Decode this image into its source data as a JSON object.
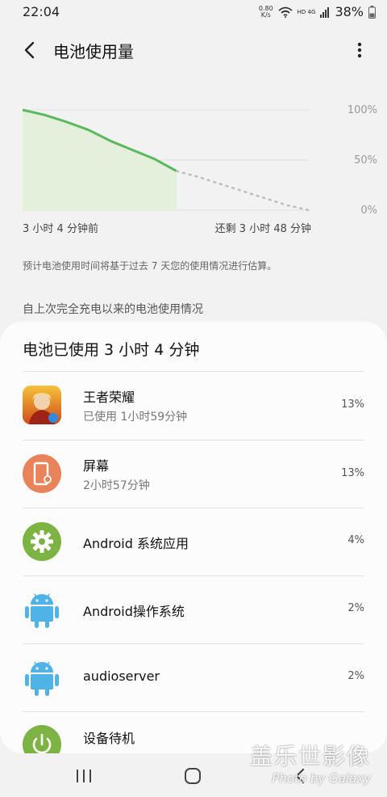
{
  "status": {
    "time": "22:04",
    "net_speed_value": "0.80",
    "net_speed_unit": "K/s",
    "network_label": "HD 4G",
    "battery_percent": "38%"
  },
  "header": {
    "title": "电池使用量"
  },
  "chart": {
    "left_label": "3 小时 4 分钟前",
    "right_label": "还剩 3 小时 48 分钟",
    "y_ticks": [
      "100%",
      "50%",
      "0%"
    ],
    "colors": {
      "usage_line": "#5cb85c",
      "usage_fill": "#dff0d8",
      "prediction": "#bdbdbd"
    }
  },
  "chart_data": {
    "type": "line",
    "series": [
      {
        "values": [
          100,
          95,
          88,
          80,
          69,
          60,
          51,
          39
        ]
      },
      {
        "values": [
          39,
          33,
          26,
          19,
          12,
          5,
          0
        ]
      }
    ],
    "ylim": [
      0,
      100
    ],
    "yticks": [
      "100%",
      "50%",
      "0%"
    ]
  },
  "estimate_note": "预计电池使用时间将基于过去 7 天您的使用情况进行估算。",
  "section_header": "自上次完全充电以来的电池使用情况",
  "usage_card": {
    "title": "电池已使用 3 小时 4 分钟",
    "items": [
      {
        "name": "王者荣耀",
        "detail": "已使用 1小时59分钟",
        "percent": "13%",
        "icon": "game-app-icon"
      },
      {
        "name": "屏幕",
        "detail": "2小时57分钟",
        "percent": "13%",
        "icon": "screen-icon"
      },
      {
        "name": "Android 系统应用",
        "detail": "",
        "percent": "4%",
        "icon": "gear-icon"
      },
      {
        "name": "Android操作系统",
        "detail": "",
        "percent": "2%",
        "icon": "android-icon"
      },
      {
        "name": "audioserver",
        "detail": "",
        "percent": "2%",
        "icon": "android-icon"
      },
      {
        "name": "设备待机",
        "detail": "",
        "percent": "",
        "icon": "power-icon"
      }
    ]
  },
  "watermark": {
    "line1": "盖乐世影像",
    "line2": "Photo by Galaxy"
  }
}
